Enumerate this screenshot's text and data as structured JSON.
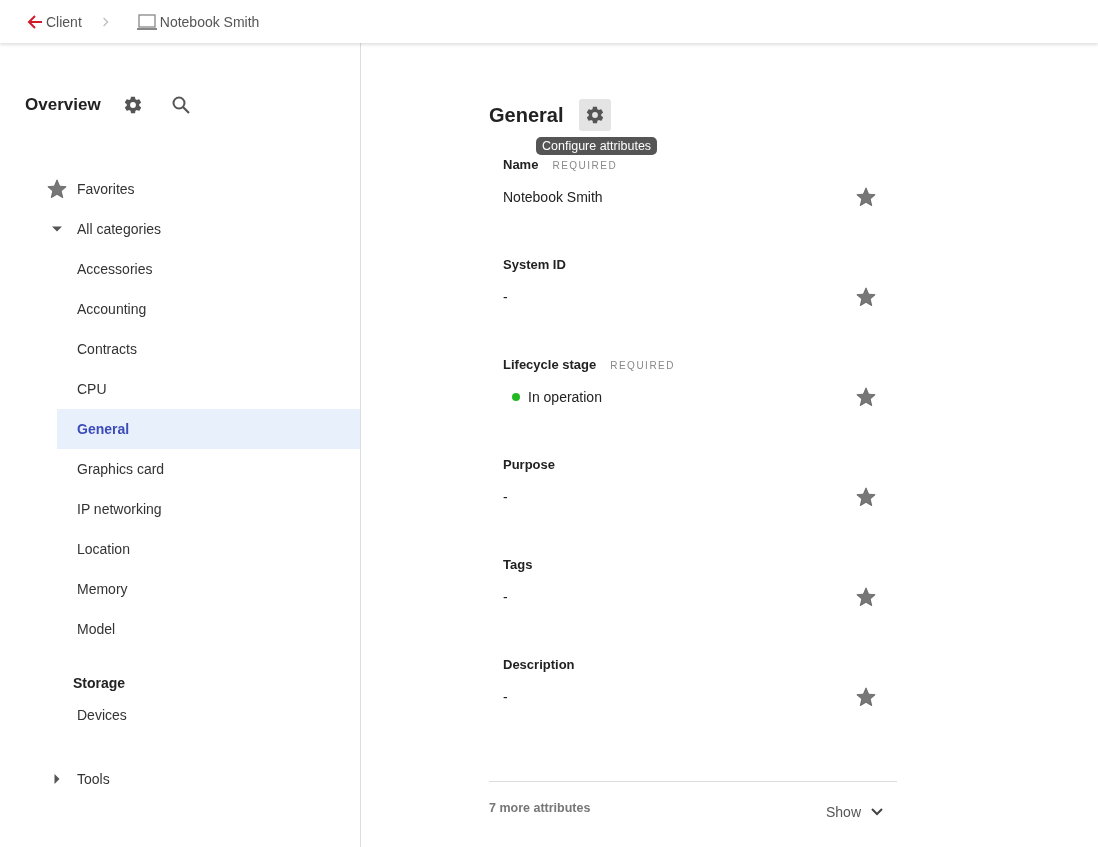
{
  "breadcrumb": {
    "back": "Client",
    "current": "Notebook Smith"
  },
  "sidebar": {
    "title": "Overview",
    "items": [
      {
        "kind": "favorites",
        "label": "Favorites"
      },
      {
        "kind": "group",
        "label": "All categories",
        "expanded": true,
        "children": [
          {
            "label": "Accessories",
            "selected": false
          },
          {
            "label": "Accounting",
            "selected": false
          },
          {
            "label": "Contracts",
            "selected": false
          },
          {
            "label": "CPU",
            "selected": false
          },
          {
            "label": "General",
            "selected": true
          },
          {
            "label": "Graphics card",
            "selected": false
          },
          {
            "label": "IP networking",
            "selected": false
          },
          {
            "label": "Location",
            "selected": false
          },
          {
            "label": "Memory",
            "selected": false
          },
          {
            "label": "Model",
            "selected": false
          }
        ]
      },
      {
        "kind": "section",
        "label": "Storage",
        "children": [
          {
            "label": "Devices",
            "selected": false
          }
        ]
      },
      {
        "kind": "group",
        "label": "Tools",
        "expanded": false
      }
    ]
  },
  "main": {
    "title": "General",
    "tooltip": "Configure attributes",
    "attributes": [
      {
        "label": "Name",
        "badge": "REQUIRED",
        "value": "Notebook Smith"
      },
      {
        "label": "System ID",
        "value": "-"
      },
      {
        "label": "Lifecycle stage",
        "badge": "REQUIRED",
        "value": "In operation",
        "color": "#22b822"
      },
      {
        "label": "Purpose",
        "value": "-"
      },
      {
        "label": "Tags",
        "value": "-"
      },
      {
        "label": "Description",
        "value": "-"
      }
    ],
    "more": "7 more attributes",
    "show_button": "Show"
  }
}
